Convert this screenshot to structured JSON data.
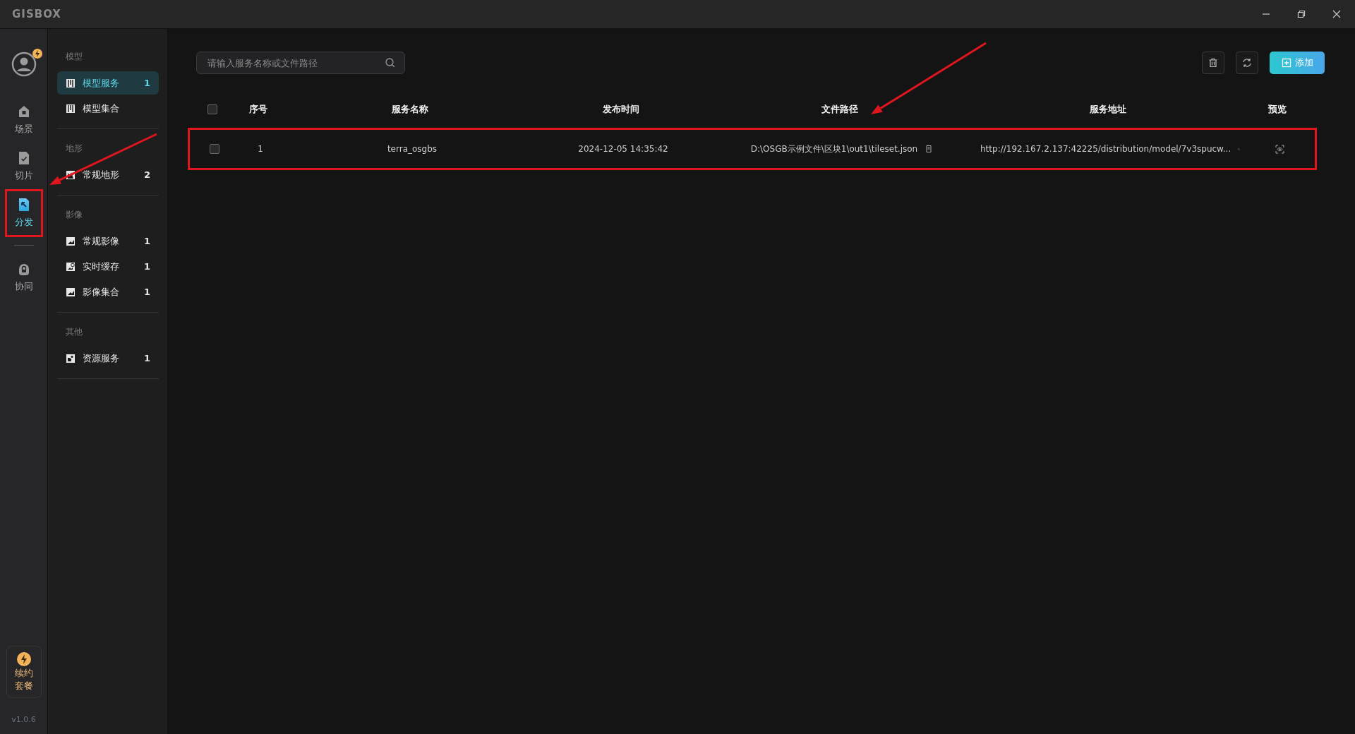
{
  "window": {
    "logo": "GISBOX"
  },
  "rail": {
    "items": [
      {
        "kind": "home",
        "label": "场景",
        "selected": false,
        "highlighted": false
      },
      {
        "kind": "check",
        "label": "切片",
        "selected": false,
        "highlighted": false
      },
      {
        "kind": "distribute",
        "label": "分发",
        "selected": true,
        "highlighted": true
      },
      {
        "kind": "lock",
        "label": "协同",
        "selected": false,
        "highlighted": false
      }
    ],
    "renew": {
      "line_1": "续约",
      "line_2": "套餐"
    },
    "version": "v1.0.6"
  },
  "nav": {
    "groups": [
      {
        "title": "模型",
        "items": [
          {
            "kind": "model",
            "label": "模型服务",
            "count": "1",
            "selected": true
          },
          {
            "kind": "model",
            "label": "模型集合",
            "selected": false
          }
        ]
      },
      {
        "title": "地形",
        "items": [
          {
            "kind": "terrain",
            "label": "常规地形",
            "count": "2",
            "selected": false
          }
        ]
      },
      {
        "title": "影像",
        "items": [
          {
            "kind": "image",
            "label": "常规影像",
            "count": "1",
            "selected": false
          },
          {
            "kind": "cache",
            "label": "实时缓存",
            "count": "1",
            "selected": false
          },
          {
            "kind": "image",
            "label": "影像集合",
            "count": "1",
            "selected": false
          }
        ]
      },
      {
        "title": "其他",
        "items": [
          {
            "kind": "resource",
            "label": "资源服务",
            "count": "1",
            "selected": false
          }
        ]
      }
    ]
  },
  "search": {
    "placeholder": "请输入服务名称或文件路径"
  },
  "toolbar": {
    "add_label": "添加"
  },
  "table": {
    "columns": [
      "序号",
      "服务名称",
      "发布时间",
      "文件路径",
      "服务地址",
      "预览"
    ],
    "all_checked": false,
    "rows": [
      {
        "checked": false,
        "highlighted": true,
        "index": "1",
        "name": "terra_osgbs",
        "time": "2024-12-05 14:35:42",
        "path": "D:\\OSGB示例文件\\区块1\\out1\\tileset.json",
        "url": "http://192.167.2.137:42225/distribution/model/7v3spucw..."
      }
    ]
  },
  "annotations": [
    {
      "kind": "arrow"
    },
    {
      "kind": "arrow"
    }
  ]
}
